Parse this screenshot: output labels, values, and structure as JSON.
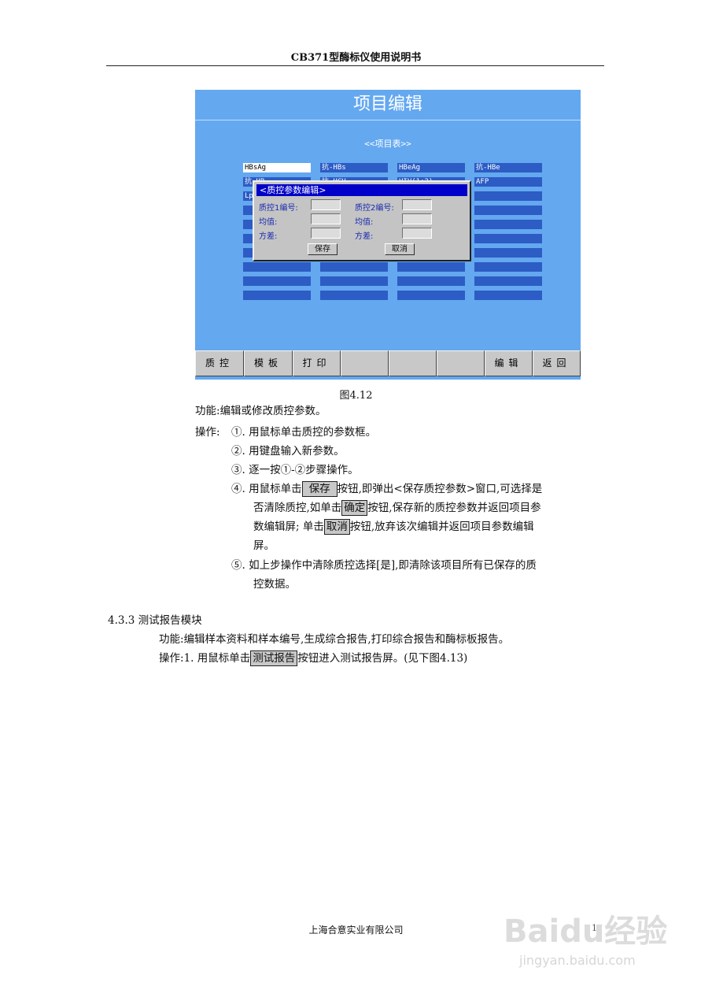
{
  "header": {
    "title": "CB371型酶标仪使用说明书"
  },
  "screen": {
    "title": "项目编辑",
    "subtitle": "<<项目表>>",
    "rows": [
      [
        "HBsAg",
        "抗-HBs",
        "HBeAg",
        "抗-HBe"
      ],
      [
        "抗-HB",
        "抗-HCV",
        "HIV(1+2)",
        "AFP"
      ],
      [
        "Lp",
        "",
        "",
        ""
      ],
      [
        "",
        "",
        "",
        ""
      ],
      [
        "",
        "",
        "",
        ""
      ],
      [
        "",
        "",
        "",
        ""
      ],
      [
        "",
        "",
        "",
        ""
      ],
      [
        "",
        "",
        "",
        ""
      ],
      [
        "",
        "",
        "",
        ""
      ],
      [
        "",
        "",
        "",
        ""
      ]
    ],
    "dialog": {
      "title": "<质控参数编辑>",
      "qc1_id": "质控1编号:",
      "qc2_id": "质控2编号:",
      "mean1": "均值:",
      "mean2": "均值:",
      "var1": "方差:",
      "var2": "方差:",
      "save": "保存",
      "cancel": "取消"
    },
    "bottom_bar": [
      "质控",
      "模板",
      "打印",
      "",
      "",
      "",
      "编辑",
      "返回"
    ]
  },
  "figure_caption": "图4.12",
  "body": {
    "func_label": "功能:",
    "func_text": "编辑或修改质控参数。",
    "op_label": "操作:",
    "step1": "①. 用鼠标单击质控的参数框。",
    "step2": "②. 用键盘输入新参数。",
    "step3": "③. 逐一按①-②步骤操作。",
    "step4_a": "④. 用鼠标单击",
    "step4_btn_save": "保存",
    "step4_b": "按钮,即弹出<保存质控参数>窗口,可选择是",
    "step4_c": "否清除质控,如单击",
    "step4_btn_ok": "确定",
    "step4_d": "按钮,保存新的质控参数并返回项目参",
    "step4_e": "数编辑屏; 单击",
    "step4_btn_cancel": "取消",
    "step4_f": "按钮,放弃该次编辑并返回项目参数编辑",
    "step4_g": "屏。",
    "step5_a": "⑤. 如上步操作中清除质控选择[是],即清除该项目所有已保存的质",
    "step5_b": "控数据。"
  },
  "section": {
    "heading": "4.3.3 测试报告模块",
    "func_label": "功能:",
    "func_text": "编辑样本资料和样本编号,生成综合报告,打印综合报告和酶标板报告。",
    "op_label": "操作:",
    "op_a": "1. 用鼠标单击",
    "op_btn": "测试报告",
    "op_b": "按钮进入测试报告屏。(见下图4.13)"
  },
  "footer": {
    "company": "上海合意实业有限公司",
    "page": "17"
  },
  "watermark": {
    "logo": "Baidu经验",
    "url": "jingyan.baidu.com"
  }
}
